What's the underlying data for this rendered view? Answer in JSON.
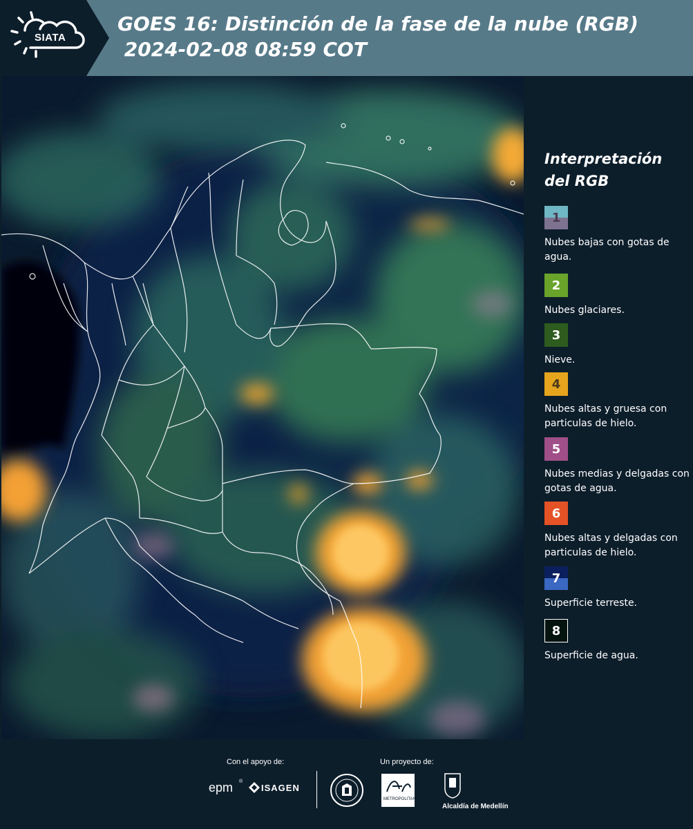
{
  "header": {
    "logo_text": "SIATA",
    "title_line1": "GOES 16: Distinción de la fase de la nube (RGB)",
    "title_line2": " 2024-02-08 08:59 COT"
  },
  "legend": {
    "title": "Interpretación del RGB",
    "items": [
      {
        "number": "1",
        "label": "Nubes bajas con gotas de agua.",
        "color_top": "#6fb7c5",
        "color_bottom": "#7d7390"
      },
      {
        "number": "2",
        "label": "Nubes glaciares.",
        "color": "#6aa42b"
      },
      {
        "number": "3",
        "label": "Nieve.",
        "color": "#2e5c1e"
      },
      {
        "number": "4",
        "label": "Nubes altas y gruesa con particulas de hielo.",
        "color": "#e6a51d"
      },
      {
        "number": "5",
        "label": "Nubes medias y delgadas con gotas de agua.",
        "color": "#a04f88"
      },
      {
        "number": "6",
        "label": "Nubes altas y delgadas con particulas de hielo.",
        "color": "#e45226"
      },
      {
        "number": "7",
        "label": "Superficie terreste.",
        "color_top": "#0b1f5e",
        "color_bottom": "#3a68c2"
      },
      {
        "number": "8",
        "label": "Superficie de agua.",
        "color": "#06140f"
      }
    ]
  },
  "footer": {
    "support_label": "Con el apoyo de:",
    "project_label": "Un proyecto de:",
    "sponsor_epm": "epm",
    "sponsor_isagen": "ISAGEN",
    "area_metropolitana": "METROPOLITANA",
    "alcaldia": "Alcaldía de Medellín"
  },
  "colors": {
    "header_bg": "#577a89",
    "page_bg": "#0d1e2b",
    "cloud_green": "#4a8a5a",
    "cloud_orange": "#f0a030"
  }
}
